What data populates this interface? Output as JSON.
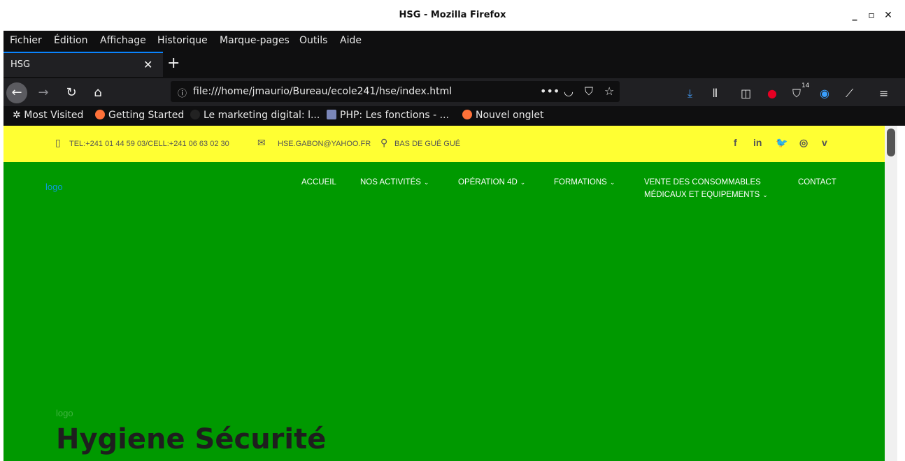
{
  "window": {
    "title": "HSG - Mozilla Firefox",
    "minimize": "_",
    "maximize": "▫",
    "close": "✕"
  },
  "menubar": [
    "Fichier",
    "Édition",
    "Affichage",
    "Historique",
    "Marque-pages",
    "Outils",
    "Aide"
  ],
  "tab": {
    "title": "HSG",
    "close": "✕",
    "new_tab": "+"
  },
  "navbar": {
    "url": "file:///home/jmaurio/Bureau/ecole241/hse/index.html",
    "badge_count": "14"
  },
  "bookmarks": [
    "Most Visited",
    "Getting Started",
    "Le marketing digital: l...",
    "PHP: Les fonctions - ...",
    "Nouvel onglet"
  ],
  "page": {
    "topbar": {
      "phone": "TEL:+241 01 44 59 03/CELL:+241 06 63 02 30",
      "email": "HSE.GABON@YAHOO.FR",
      "address": "BAS DE GUÉ GUÉ",
      "social": [
        "f",
        "in",
        "🐦",
        "◎",
        "v"
      ]
    },
    "logo": "logo",
    "nav": [
      "ACCUEIL",
      "NOS ACTIVITÉS",
      "OPÉRATION 4D",
      "FORMATIONS",
      "VENTE DES CONSOMMABLES",
      "MÉDICAUX ET EQUIPEMENTS",
      "CONTACT"
    ],
    "hero": {
      "logo": "logo",
      "title": "Hygiene Sécurité"
    }
  },
  "colors": {
    "topbar_bg": "#ffff33",
    "page_bg": "#009900",
    "chrome_bg": "#0f0f10",
    "accent": "#0a84ff"
  }
}
